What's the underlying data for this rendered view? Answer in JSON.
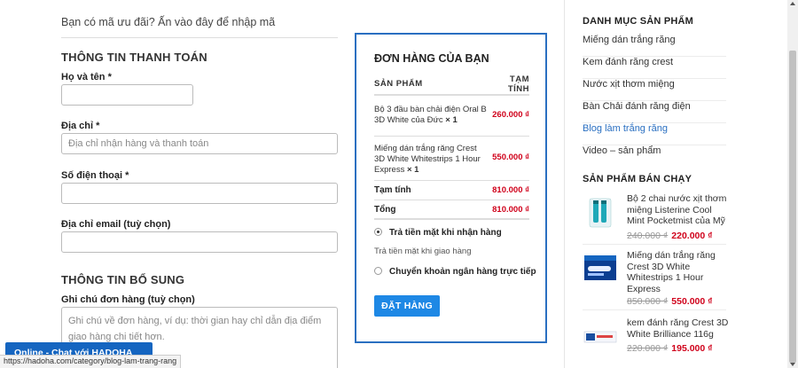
{
  "coupon": {
    "text": "Bạn có mã ưu đãi? Ấn vào đây để nhập mã"
  },
  "billing": {
    "title": "THÔNG TIN THANH TOÁN",
    "name_label": "Họ và tên",
    "address_label": "Địa chỉ",
    "address_placeholder": "Địa chỉ nhận hàng và thanh toán",
    "phone_label": "Số điện thoại",
    "email_label": "Địa chỉ email (tuỳ chọn)",
    "required_mark": "*"
  },
  "additional": {
    "title": "THÔNG TIN BỔ SUNG",
    "notes_label": "Ghi chú đơn hàng (tuỳ chọn)",
    "notes_placeholder": "Ghi chú về đơn hàng, ví dụ: thời gian hay chỉ dẫn địa điểm giao hàng chi tiết hơn."
  },
  "order": {
    "title": "ĐƠN HÀNG CỦA BẠN",
    "col_product": "SẢN PHẨM",
    "col_subtotal_1": "TẠM",
    "col_subtotal_2": "TÍNH",
    "items": [
      {
        "name": "Bộ 3 đầu bàn chải điện Oral B 3D White của Đức",
        "qty": "× 1",
        "price": "260.000 ₫"
      },
      {
        "name": "Miếng dán trắng răng Crest 3D White Whitestrips 1 Hour Express",
        "qty": "× 1",
        "price": "550.000 ₫"
      }
    ],
    "subtotal_label": "Tạm tính",
    "subtotal_value": "810.000 ₫",
    "total_label": "Tổng",
    "total_value": "810.000 ₫",
    "payment_cod": "Trả tiền mặt khi nhận hàng",
    "payment_cod_desc": "Trả tiền mặt khi giao hàng",
    "payment_bank": "Chuyển khoản ngân hàng trực tiếp",
    "place_order": "ĐẶT HÀNG",
    "accent": "#2a6fc1",
    "price_color": "#d0021b"
  },
  "sidebar": {
    "categories_title": "DANH MỤC SẢN PHẨM",
    "categories": [
      "Miếng dán trắng răng",
      "Kem đánh răng crest",
      "Nước xịt thơm miệng",
      "Bàn Chải đánh răng điện",
      "Blog làm trắng răng",
      "Video – sản phẩm"
    ],
    "bestsellers_title": "SẢN PHẨM BÁN CHẠY",
    "products": [
      {
        "name": "Bộ 2 chai nước xịt thơm miệng Listerine Cool Mint Pocketmist của Mỹ",
        "old": "240.000 ₫",
        "new": "220.000 ₫",
        "icon": "mouth-spray-icon"
      },
      {
        "name": "Miếng dán trắng răng Crest 3D White Whitestrips 1 Hour Express",
        "old": "850.000 ₫",
        "new": "550.000 ₫",
        "icon": "whitestrips-box-icon"
      },
      {
        "name": "kem đánh răng Crest 3D White Brilliance 116g",
        "old": "220.000 ₫",
        "new": "195.000 ₫",
        "icon": "toothpaste-icon"
      }
    ]
  },
  "floating": {
    "chat_label": "Online - Chat với HADOHA",
    "status_url": "https://hadoha.com/category/blog-lam-trang-rang"
  }
}
